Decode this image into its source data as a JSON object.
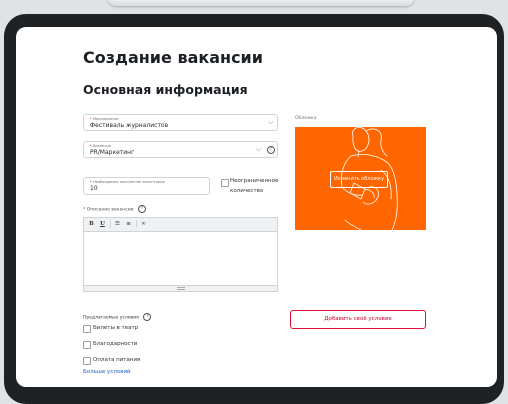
{
  "page": {
    "title": "Создание вакансии",
    "section": "Основная информация"
  },
  "event": {
    "label": "Мероприятие",
    "value": "Фестиваль журналистов"
  },
  "vacancy": {
    "label": "Вакансия",
    "value": "PR/Маркетинг"
  },
  "volunteers": {
    "label": "Необходимое количество волонтеров",
    "value": "10",
    "unlimited_line1": "Неограниченное",
    "unlimited_line2": "количество"
  },
  "description": {
    "label": "Описание вакансии",
    "value": ""
  },
  "cover": {
    "label": "Обложка",
    "change_button": "Изменить обложку",
    "color": "#ff6600"
  },
  "conditions": {
    "label": "Предлагаемые условия",
    "items": [
      {
        "label": "Билеты в театр",
        "checked": false
      },
      {
        "label": "Благодарности",
        "checked": false
      },
      {
        "label": "Оплата питания",
        "checked": false
      }
    ],
    "more": "Больше условий",
    "add_button": "Добавить своё условие"
  },
  "colors": {
    "accent": "#e0103c",
    "link": "#1f61c4"
  }
}
